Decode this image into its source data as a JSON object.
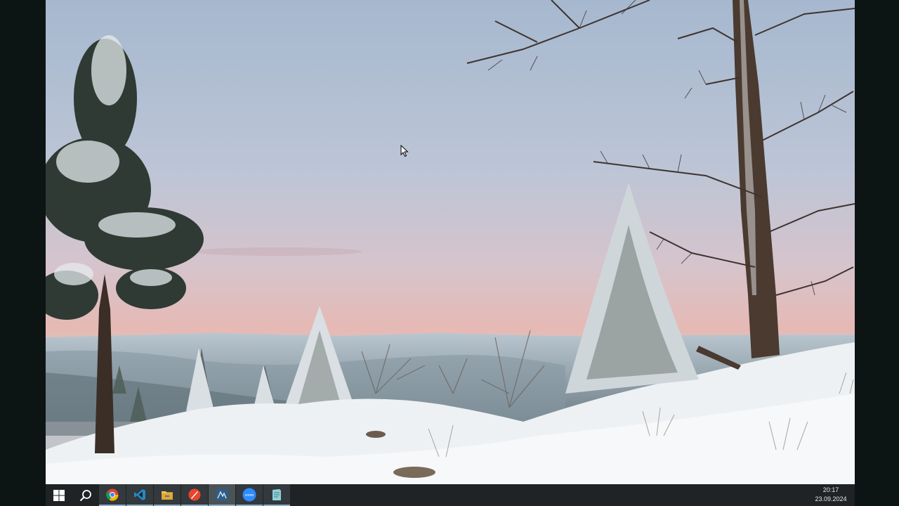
{
  "taskbar": {
    "apps": [
      {
        "icon": "windows-start-icon"
      },
      {
        "icon": "search-icon"
      },
      {
        "icon": "chrome-icon"
      },
      {
        "icon": "vscode-icon"
      },
      {
        "icon": "file-explorer-icon"
      },
      {
        "icon": "red-app-icon"
      },
      {
        "icon": "ssms-icon"
      },
      {
        "icon": "zoom-icon",
        "label": "zoom"
      },
      {
        "icon": "notes-app-icon"
      }
    ],
    "clock": {
      "time": "20:17",
      "date": "23.09.2024"
    }
  },
  "colors": {
    "taskbar": "#1f2326",
    "sky_top": "#a9bcd2",
    "sky_horizon": "#e8b6b0",
    "snow": "#f3f5f7"
  }
}
